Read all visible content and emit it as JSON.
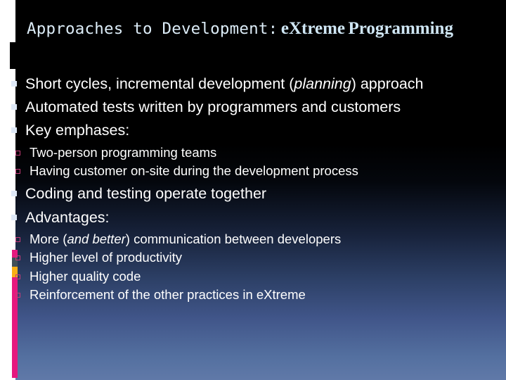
{
  "slide": {
    "title": {
      "mono_part": "Approaches to Development:",
      "serif_part_1": "eXtreme",
      "serif_part_2": "Programming"
    },
    "bullets": [
      {
        "level": 1,
        "text_before_italic": "Short cycles, incremental development (",
        "italic": "planning",
        "text_after_italic": ") approach",
        "full_text": "Short cycles, incremental development (planning) approach"
      },
      {
        "level": 1,
        "full_text": "Automated tests written by programmers and customers"
      },
      {
        "level": 1,
        "full_text": "Key emphases:"
      },
      {
        "level": 2,
        "full_text": "Two-person programming teams"
      },
      {
        "level": 2,
        "full_text": "Having customer on-site during the development process"
      },
      {
        "level": 1,
        "full_text": "Coding and testing operate together"
      },
      {
        "level": 1,
        "full_text": "Advantages:"
      },
      {
        "level": 2,
        "text_before_italic": "More (",
        "italic": "and better",
        "text_after_italic": ") communication between developers",
        "full_text": "More (and better) communication between developers"
      },
      {
        "level": 2,
        "full_text": "Higher level of productivity"
      },
      {
        "level": 2,
        "full_text": "Higher quality code"
      },
      {
        "level": 2,
        "full_text": "Reinforcement of the other practices in eXtreme"
      }
    ],
    "colors": {
      "background_top": "#000000",
      "background_bottom": "#6079a8",
      "title_text": "#d6e8f5",
      "body_text": "#ffffff",
      "level1_marker": "#dfe9f7",
      "level2_marker": "#c43a78",
      "accent_pink": "#e6187e",
      "accent_slate": "#414f57",
      "accent_orange": "#f9ae15",
      "left_margin": "#ffffff"
    }
  }
}
